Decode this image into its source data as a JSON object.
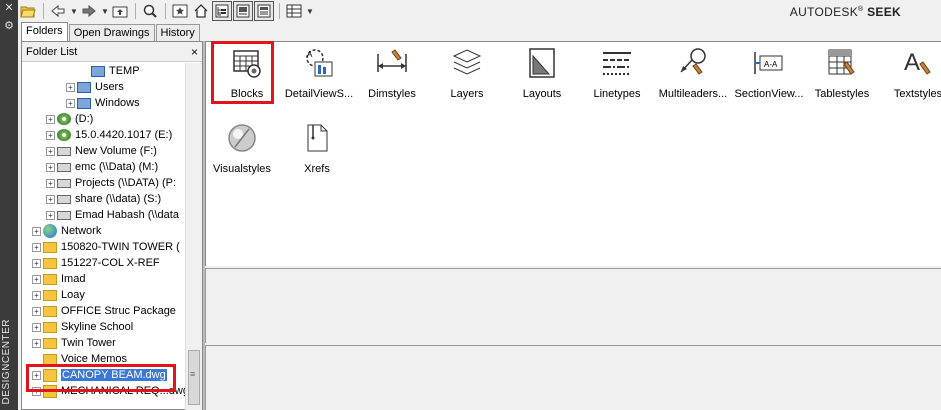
{
  "palette": {
    "title": "DESIGNCENTER"
  },
  "brand": {
    "name": "AUTODESK",
    "reg": "®",
    "product": "SEEK"
  },
  "toolbar": {
    "buttons": [
      "load-icon",
      "back-icon",
      "forward-icon",
      "up-icon",
      "search-icon",
      "favorites-icon",
      "home-icon",
      "tree-toggle-icon",
      "preview-icon",
      "description-icon",
      "views-icon"
    ]
  },
  "tabs": [
    "Folders",
    "Open Drawings",
    "History"
  ],
  "folder_list": {
    "header": "Folder List",
    "close": "×",
    "items": [
      {
        "label": "TEMP",
        "type": "folder",
        "indent": 3,
        "plus": false
      },
      {
        "label": "Users",
        "type": "folder",
        "indent": 2,
        "plus": true
      },
      {
        "label": "Windows",
        "type": "folder",
        "indent": 2,
        "plus": true
      },
      {
        "label": "(D:)",
        "type": "cd",
        "indent": 1,
        "plus": true
      },
      {
        "label": "15.0.4420.1017 (E:)",
        "type": "cd",
        "indent": 1,
        "plus": true
      },
      {
        "label": "New Volume (F:)",
        "type": "drive",
        "indent": 1,
        "plus": true
      },
      {
        "label": "emc (\\\\Data) (M:)",
        "type": "drive",
        "indent": 1,
        "plus": true
      },
      {
        "label": "Projects (\\\\DATA) (P:",
        "type": "drive",
        "indent": 1,
        "plus": true
      },
      {
        "label": "share (\\\\data) (S:)",
        "type": "drive",
        "indent": 1,
        "plus": true
      },
      {
        "label": "Emad Habash (\\\\data",
        "type": "drive",
        "indent": 1,
        "plus": true
      },
      {
        "label": "Network",
        "type": "network",
        "indent": 0,
        "plus": true
      },
      {
        "label": "150820-TWIN TOWER (",
        "type": "folder",
        "indent": 0,
        "plus": true
      },
      {
        "label": "151227-COL  X-REF",
        "type": "folder",
        "indent": 0,
        "plus": true
      },
      {
        "label": "Imad",
        "type": "folder",
        "indent": 0,
        "plus": true
      },
      {
        "label": "Loay",
        "type": "folder",
        "indent": 0,
        "plus": true
      },
      {
        "label": "OFFICE Struc Package",
        "type": "folder",
        "indent": 0,
        "plus": true
      },
      {
        "label": "Skyline School",
        "type": "folder",
        "indent": 0,
        "plus": true
      },
      {
        "label": "Twin Tower",
        "type": "folder",
        "indent": 0,
        "plus": true
      },
      {
        "label": "Voice Memos",
        "type": "folder",
        "indent": 0,
        "plus": false
      },
      {
        "label": "CANOPY BEAM.dwg",
        "type": "dwg",
        "indent": 0,
        "plus": true,
        "selected": true
      },
      {
        "label": "MECHANICAL REQ...dwg",
        "type": "dwg",
        "indent": 0,
        "plus": true
      }
    ]
  },
  "content_items": [
    {
      "label": "Blocks",
      "icon": "blocks-icon"
    },
    {
      "label": "DetailViewS...",
      "icon": "detail-view-icon"
    },
    {
      "label": "Dimstyles",
      "icon": "dimstyles-icon"
    },
    {
      "label": "Layers",
      "icon": "layers-icon"
    },
    {
      "label": "Layouts",
      "icon": "layouts-icon"
    },
    {
      "label": "Linetypes",
      "icon": "linetypes-icon"
    },
    {
      "label": "Multileaders...",
      "icon": "multileaders-icon"
    },
    {
      "label": "SectionView...",
      "icon": "section-view-icon"
    },
    {
      "label": "Tablestyles",
      "icon": "tablestyles-icon"
    },
    {
      "label": "Textstyles",
      "icon": "textstyles-icon"
    },
    {
      "label": "Visualstyles",
      "icon": "visualstyles-icon"
    },
    {
      "label": "Xrefs",
      "icon": "xrefs-icon"
    }
  ],
  "colors": {
    "highlight_box": "#e0141b",
    "selection": "#3a78d6",
    "strip": "#3b3b3b"
  }
}
